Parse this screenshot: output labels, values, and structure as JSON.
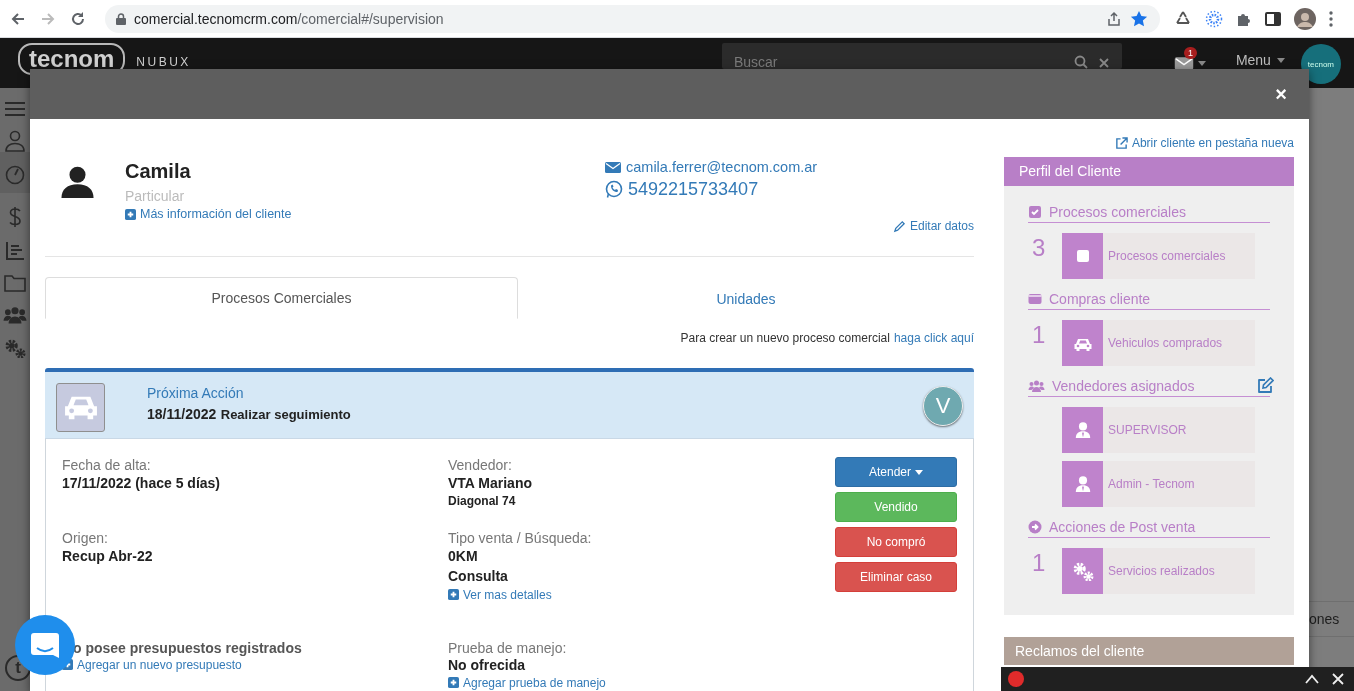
{
  "browser": {
    "url_host": "comercial.tecnomcrm.com",
    "url_path": "/comercial#/supervision"
  },
  "app_header": {
    "logo": "tecnom",
    "product": "NUBUX",
    "search_placeholder": "Buscar",
    "mail_count": "1",
    "menu": "Menu",
    "avatar": "tecnom"
  },
  "background": {
    "right_text": "ones",
    "bottom_logo": "t"
  },
  "modal": {
    "close": "×",
    "client": {
      "name": "Camila",
      "type": "Particular",
      "more_info": "Más información del cliente",
      "email": "camila.ferrer@tecnom.com.ar",
      "phone": "5492215733407",
      "edit": "Editar datos"
    },
    "tabs": [
      {
        "label": "Procesos Comerciales",
        "selected": true
      },
      {
        "label": "Unidades",
        "selected": false
      }
    ],
    "create_hint": {
      "text": "Para crear un nuevo proceso comercial",
      "link": "haga click aquí"
    },
    "process": {
      "next_action_label": "Próxima Acción",
      "next_action_date": "18/11/2022",
      "next_action": "Realizar seguimiento",
      "seller_initial": "V",
      "fields": [
        {
          "kind": "info",
          "label": "Fecha de alta:",
          "values": [
            {
              "text": "17/11/2022 (hace 5 días)",
              "kind": "normal"
            }
          ]
        },
        {
          "kind": "info",
          "label": "Vendedor:",
          "values": [
            {
              "text": "VTA Mariano",
              "kind": "normal"
            },
            {
              "text": "Diagonal 74",
              "kind": "small"
            }
          ]
        },
        {
          "kind": "info",
          "label": "Origen:",
          "values": [
            {
              "text": "Recup Abr-22",
              "kind": "normal"
            }
          ]
        },
        {
          "kind": "info",
          "label": "Tipo venta / Búsqueda:",
          "values": [
            {
              "text": "0KM",
              "kind": "normal"
            },
            {
              "text": "Consulta",
              "kind": "normal"
            }
          ],
          "link": "Ver mas detalles"
        },
        {
          "kind": "notice",
          "text": "o posee presupuestos registrados",
          "link": "Agregar un nuevo presupuesto"
        },
        {
          "kind": "info",
          "label": "Prueba de manejo:",
          "values": [
            {
              "text": "No ofrecida",
              "kind": "normal"
            }
          ],
          "link": "Agregar prueba de manejo"
        }
      ],
      "buttons": [
        {
          "label": "Atender",
          "kind": "primary",
          "dropdown": true
        },
        {
          "label": "Vendido",
          "kind": "success",
          "dropdown": false
        },
        {
          "label": "No compró",
          "kind": "danger",
          "dropdown": false
        },
        {
          "label": "Eliminar caso",
          "kind": "danger",
          "dropdown": false
        }
      ]
    },
    "open_new_tab": "Abrir cliente en pestaña nueva",
    "profile": {
      "title": "Perfil del Cliente",
      "sections": [
        {
          "title": "Procesos comerciales",
          "kind": "check",
          "editable": false,
          "items": [
            {
              "count": "3",
              "label": "Procesos comerciales",
              "kind": "check"
            }
          ]
        },
        {
          "title": "Compras cliente",
          "kind": "wallet",
          "editable": false,
          "items": [
            {
              "count": "1",
              "label": "Vehiculos comprados",
              "kind": "car"
            }
          ]
        },
        {
          "title": "Vendedores asignados",
          "kind": "users",
          "editable": true,
          "items": [
            {
              "label": "SUPERVISOR",
              "kind": "user"
            },
            {
              "label": "Admin - Tecnom",
              "kind": "user"
            }
          ]
        },
        {
          "title": "Acciones de Post venta",
          "kind": "arrow",
          "editable": false,
          "items": [
            {
              "count": "1",
              "label": "Servicios realizados",
              "kind": "gears"
            }
          ]
        }
      ]
    },
    "complaints": {
      "title": "Reclamos del cliente"
    }
  }
}
